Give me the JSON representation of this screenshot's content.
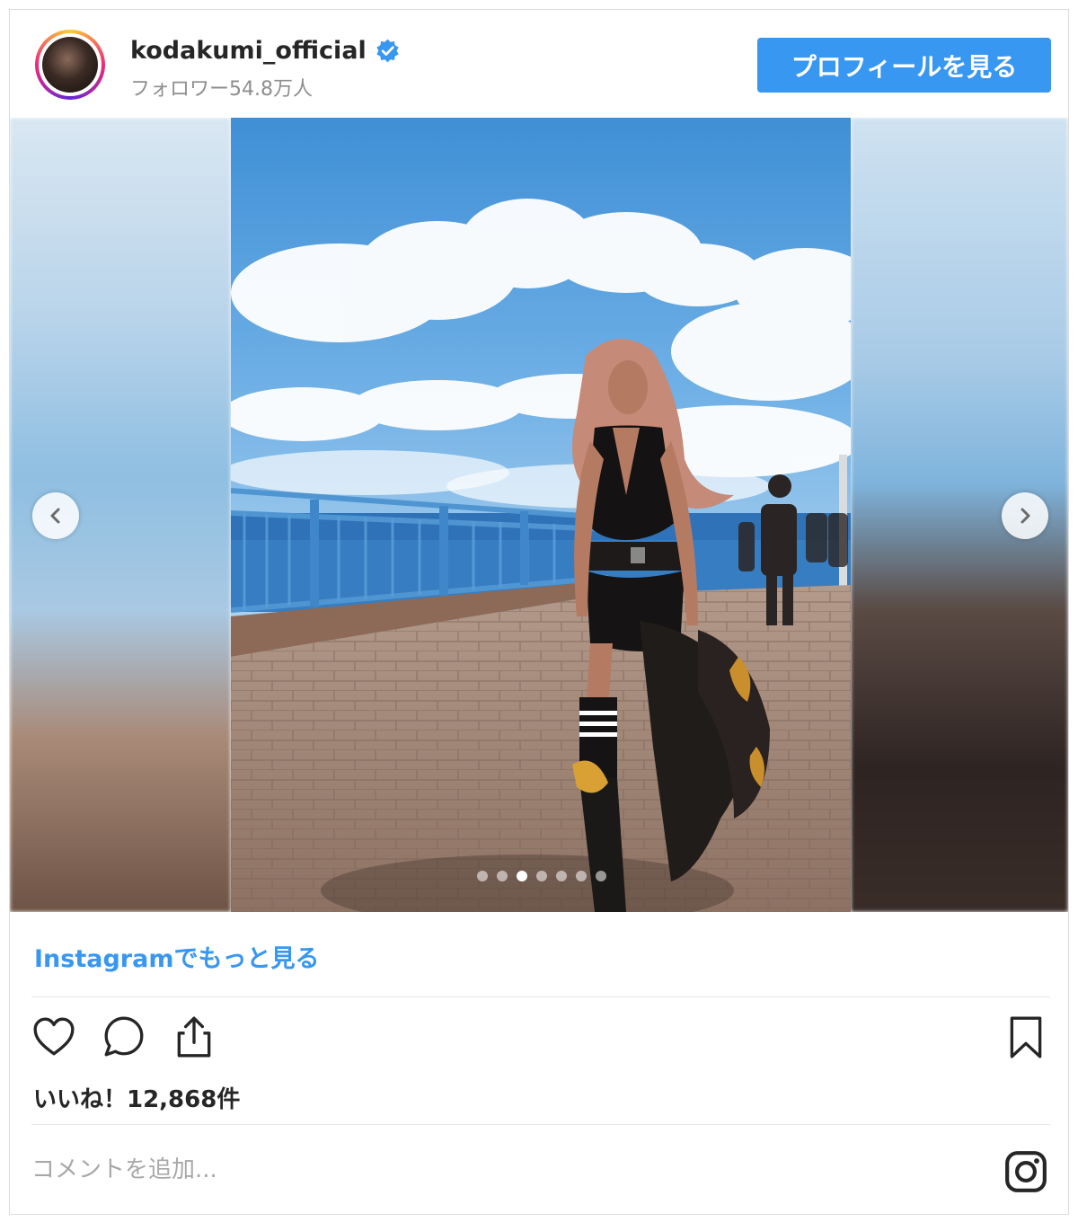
{
  "header": {
    "username": "kodakumi_official",
    "verified_icon": "verified-badge-icon",
    "followers": "フォロワー54.8万人",
    "profile_button": "プロフィールを見る"
  },
  "media": {
    "carousel_dots": 7,
    "active_dot": 3,
    "prev_icon": "chevron-left-icon",
    "next_icon": "chevron-right-icon"
  },
  "footer": {
    "more_link": "Instagramでもっと見る",
    "action_icons": [
      "heart-icon",
      "comment-icon",
      "share-icon"
    ],
    "bookmark_icon": "bookmark-icon",
    "likes": "いいね！12,868件",
    "comment_placeholder": "コメントを追加...",
    "logo_icon": "instagram-logo-icon"
  },
  "colors": {
    "accent": "#3897f0",
    "text": "#262626",
    "muted": "#8e8e8e",
    "border": "#dbdbdb"
  }
}
